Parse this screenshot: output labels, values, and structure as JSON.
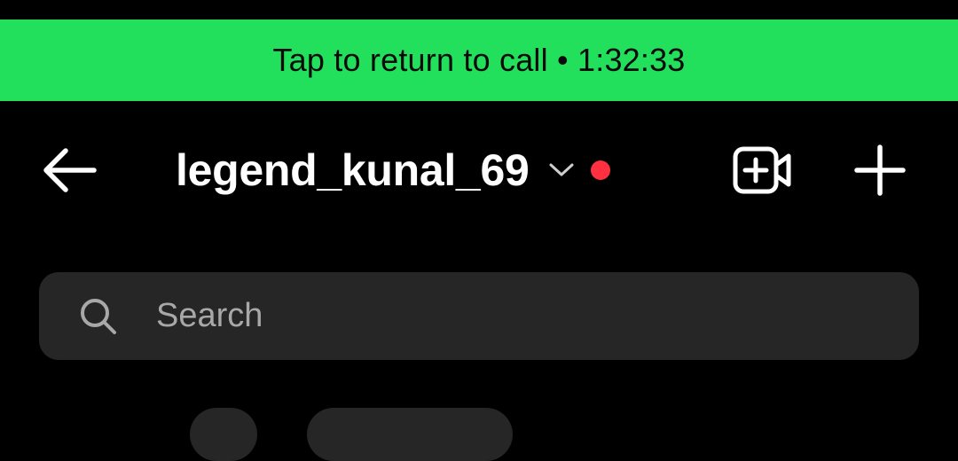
{
  "call_banner": {
    "text": "Tap to return to call • 1:32:33",
    "color": "#22e05c"
  },
  "header": {
    "username": "legend_kunal_69",
    "live_indicator_color": "#ff3040",
    "icons": {
      "back": "back-arrow-icon",
      "switcher": "chevron-down-icon",
      "video": "video-add-icon",
      "new": "plus-icon"
    }
  },
  "search": {
    "placeholder": "Search"
  }
}
